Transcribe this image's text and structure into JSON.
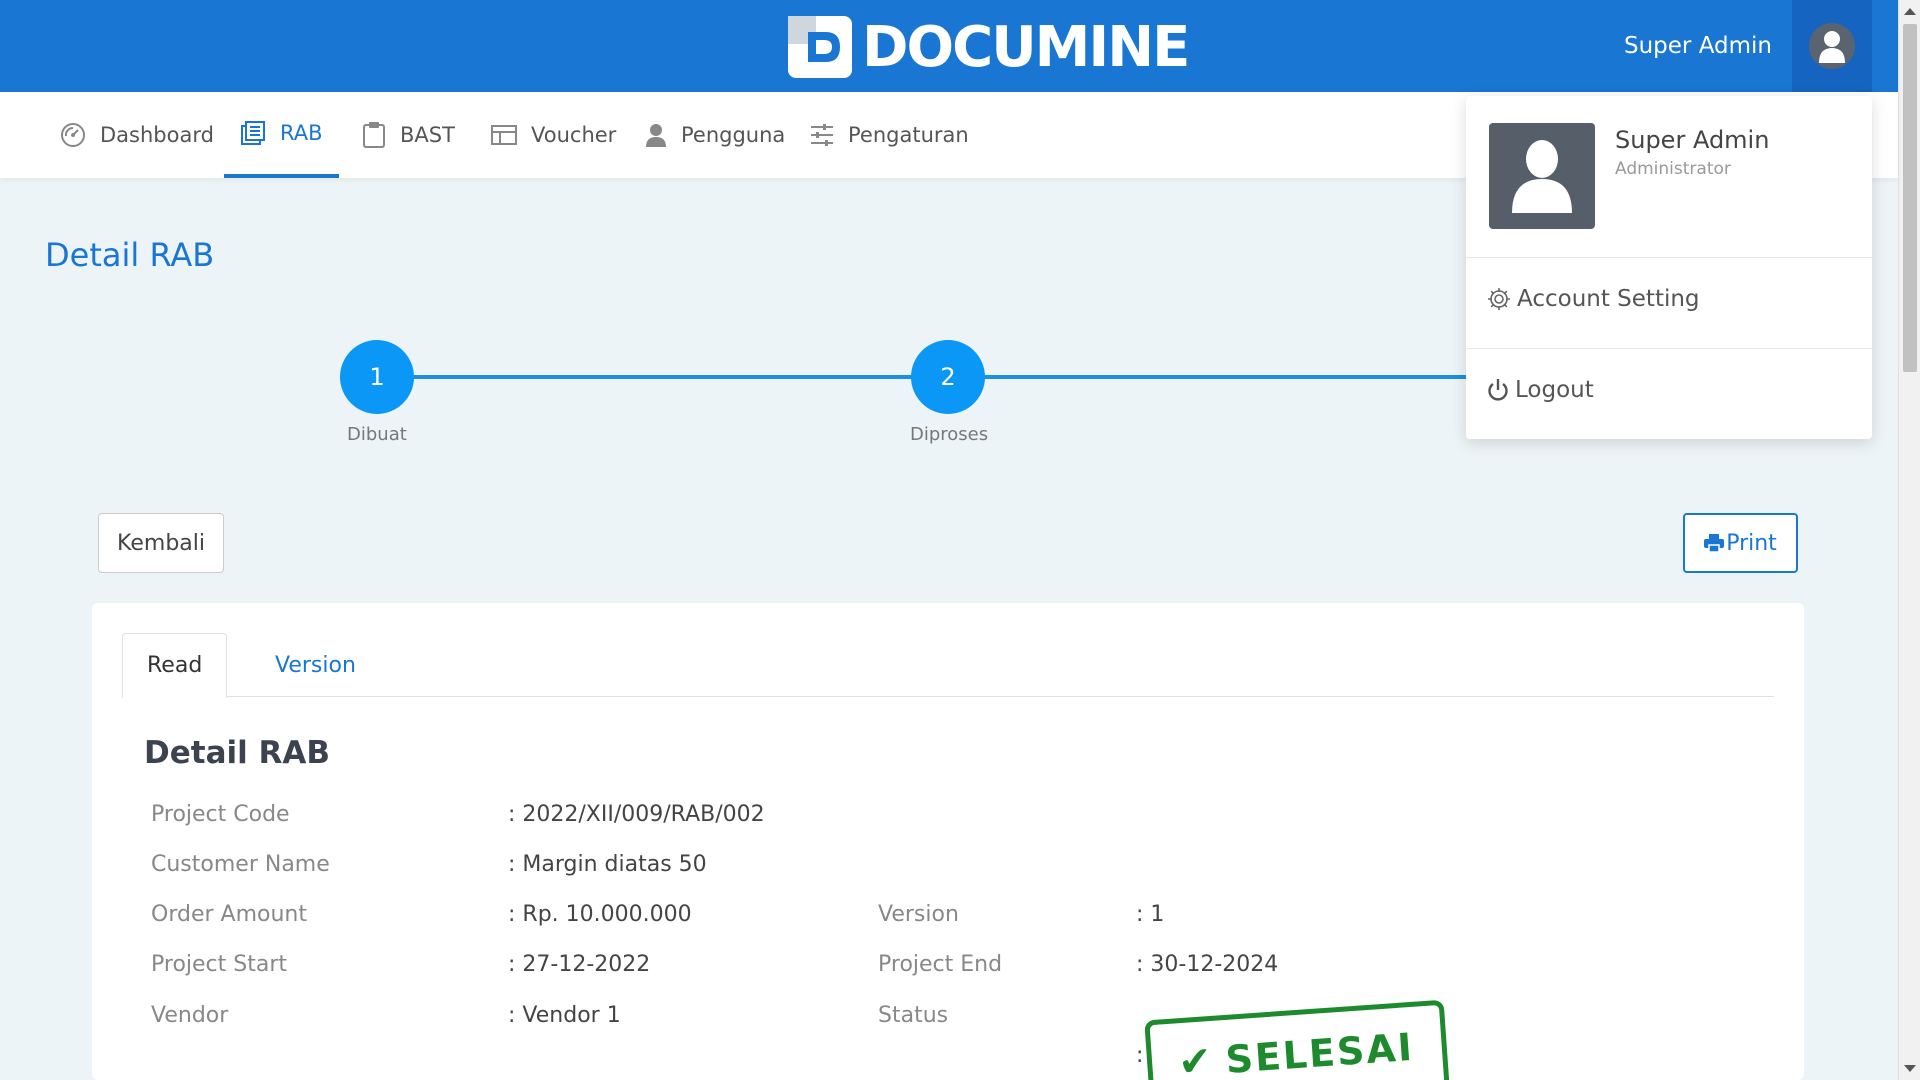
{
  "header": {
    "brand": "DOCUMINE",
    "user_name": "Super Admin"
  },
  "nav": {
    "items": [
      {
        "label": "Dashboard",
        "icon": "dashboard-gauge-icon"
      },
      {
        "label": "RAB",
        "icon": "document-list-icon",
        "active": true
      },
      {
        "label": "BAST",
        "icon": "clipboard-icon"
      },
      {
        "label": "Voucher",
        "icon": "voucher-icon"
      },
      {
        "label": "Pengguna",
        "icon": "user-icon"
      },
      {
        "label": "Pengaturan",
        "icon": "sliders-icon"
      }
    ]
  },
  "page": {
    "title": "Detail RAB"
  },
  "stepper": {
    "steps": [
      {
        "number": "1",
        "label": "Dibuat"
      },
      {
        "number": "2",
        "label": "Diproses"
      }
    ]
  },
  "buttons": {
    "back": "Kembali",
    "print": "Print"
  },
  "tabs": {
    "read": "Read",
    "version": "Version"
  },
  "detail": {
    "title": "Detail RAB",
    "fields": {
      "project_code": {
        "label": "Project Code",
        "value": ": 2022/XII/009/RAB/002"
      },
      "customer_name": {
        "label": "Customer Name",
        "value": ": Margin diatas 50"
      },
      "order_amount": {
        "label": "Order Amount",
        "value": ": Rp. 10.000.000"
      },
      "project_start": {
        "label": "Project Start",
        "value": ": 27-12-2022"
      },
      "vendor": {
        "label": "Vendor",
        "value": ": Vendor 1"
      },
      "version": {
        "label": "Version",
        "value": ": 1"
      },
      "project_end": {
        "label": "Project End",
        "value": ": 30-12-2024"
      },
      "status": {
        "label": "Status",
        "value": ":"
      }
    },
    "status_stamp": "SELESAI",
    "stamp_color": "#1e8a2e"
  },
  "user_dropdown": {
    "name": "Super Admin",
    "role": "Administrator",
    "account_setting": "Account Setting",
    "logout": "Logout"
  },
  "colors": {
    "primary": "#1976d2",
    "step": "#0a97f5",
    "background": "#edf4f7"
  }
}
